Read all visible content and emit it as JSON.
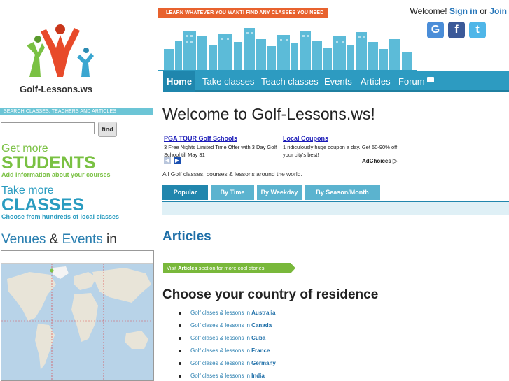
{
  "site": {
    "logo_text": "Golf-Lessons.ws",
    "banner_tag": "LEARN WHATEVER YOU WANT! FIND ANY CLASSES YOU NEED"
  },
  "account": {
    "welcome": "Welcome!",
    "sign_in": "Sign in",
    "or": "or",
    "join": "Join"
  },
  "social": {
    "google_glyph": "G",
    "facebook_glyph": "f",
    "twitter_glyph": "t"
  },
  "search": {
    "label": "SEARCH CLASSES, TEACHERS AND ARTICLES",
    "value": "",
    "button": "find"
  },
  "promos": {
    "students": {
      "small": "Get more",
      "big": "STUDENTS",
      "sub": "Add information about your courses"
    },
    "classes": {
      "small": "Take more",
      "big": "CLASSES",
      "sub": "Choose from hundreds of local classes"
    }
  },
  "venues": {
    "word1": "Venues",
    "amp": "&",
    "word2": "Events",
    "in": "in"
  },
  "nav": {
    "items": [
      {
        "label": "Home"
      },
      {
        "label": "Take classes"
      },
      {
        "label": "Teach classes"
      },
      {
        "label": "Events"
      },
      {
        "label": "Articles"
      },
      {
        "label": "Forum"
      }
    ]
  },
  "main": {
    "title": "Welcome to Golf-Lessons.ws!",
    "tagline": "All Golf classes, courses & lessons around the world."
  },
  "ads": [
    {
      "title": "PGA TOUR Golf Schools",
      "text": "3 Free Nights Limited Time Offer with 3 Day Golf School till May 31"
    },
    {
      "title": "Local Coupons",
      "text": "1 ridiculously huge coupon a day. Get 50-90% off your city's best!"
    }
  ],
  "adchoices": "AdChoices",
  "tabs": [
    {
      "label": "Popular"
    },
    {
      "label": "By Time"
    },
    {
      "label": "By Weekday"
    },
    {
      "label": "By Season/Month"
    }
  ],
  "articles": {
    "heading": "Articles",
    "visit_prefix": "Visit ",
    "visit_bold": "Articles",
    "visit_suffix": " section for more cool stories"
  },
  "countries": {
    "heading": "Choose your country of residence",
    "prefix": "Golf clases & lessons in ",
    "items": [
      "Australia",
      "Canada",
      "Cuba",
      "France",
      "Germany",
      "India"
    ]
  },
  "colors": {
    "accent_blue": "#2d9bc1",
    "accent_orange": "#e8622e",
    "accent_green": "#7ac143"
  }
}
